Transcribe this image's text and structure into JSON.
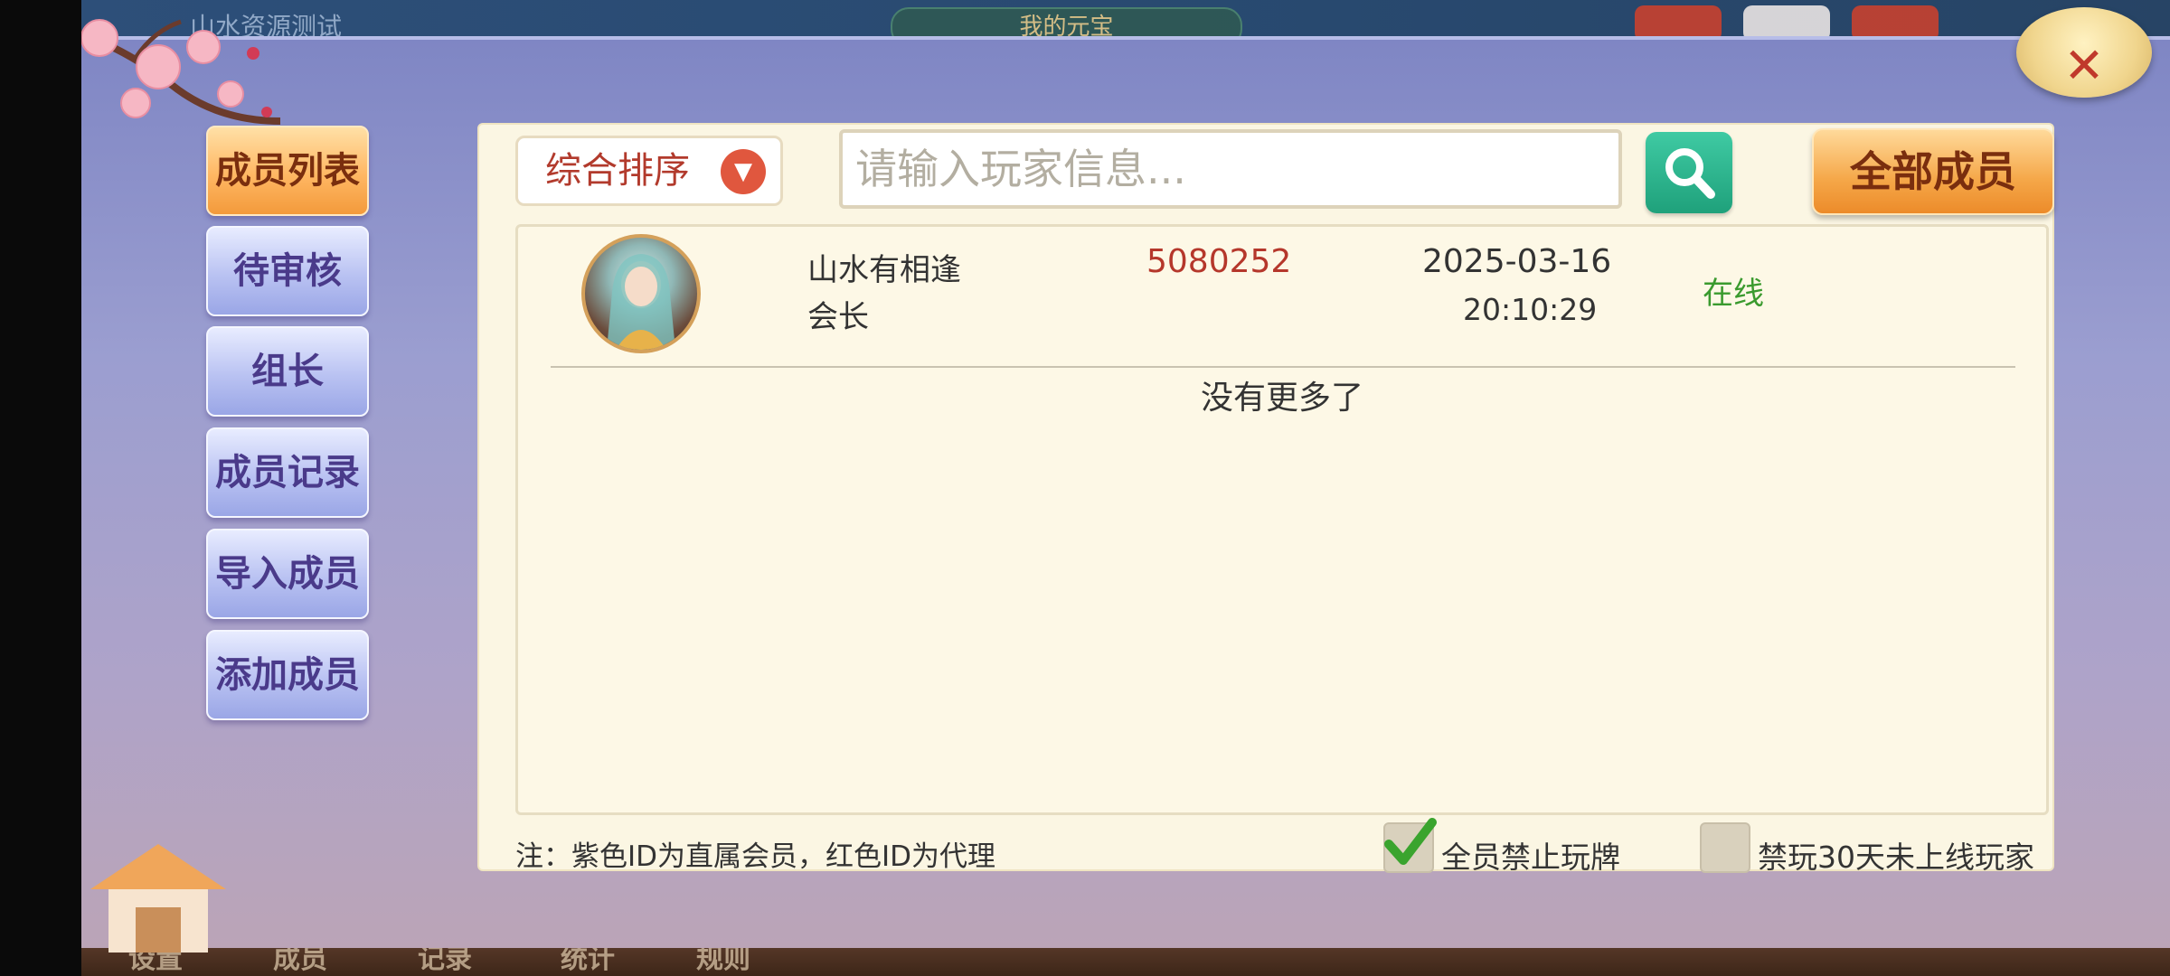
{
  "background": {
    "top_title": "山水资源测试",
    "top_pill_label": "我的元宝",
    "bottom_nav": [
      "设置",
      "成员",
      "记录",
      "统计",
      "规则"
    ]
  },
  "close_label": "✕",
  "menu": {
    "items": [
      {
        "label": "成员列表",
        "active": true
      },
      {
        "label": "待审核"
      },
      {
        "label": "组长"
      },
      {
        "label": "成员记录"
      },
      {
        "label": "导入成员"
      },
      {
        "label": "添加成员"
      }
    ]
  },
  "toolbar": {
    "sort_label": "综合排序",
    "search_placeholder": "请输入玩家信息...",
    "all_members_label": "全部成员"
  },
  "members": [
    {
      "name": "山水有相逢",
      "role": "会长",
      "id": "5080252",
      "date": "2025-03-16",
      "time": "20:10:29",
      "status": "在线"
    }
  ],
  "list_end_text": "没有更多了",
  "footer": {
    "note": "注：紫色ID为直属会员，红色ID为代理",
    "ban_all_label": "全员禁止玩牌",
    "ban_all_checked": true,
    "ban_inactive_label": "禁玩30天未上线玩家",
    "ban_inactive_checked": false
  },
  "colors": {
    "active_tab": "#f5a748",
    "id_red": "#b5372b",
    "online_green": "#3a9a2e",
    "search_green": "#1fa17b"
  }
}
